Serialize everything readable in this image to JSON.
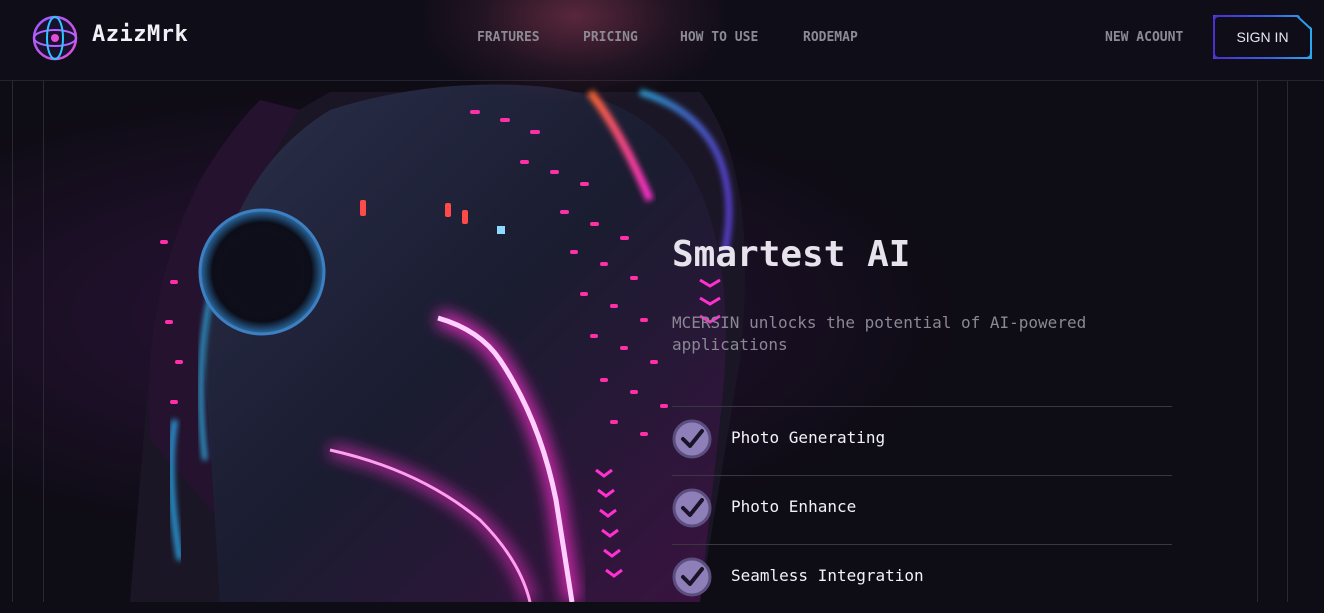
{
  "brand": {
    "name": "AzizMrk",
    "logo_icon": "globe-orbit-icon"
  },
  "nav": {
    "links": [
      "FRATURES",
      "PRICING",
      "HOW TO USE",
      "RODEMAP"
    ],
    "new_account": "NEW ACOUNT",
    "sign_in": "SIGN IN"
  },
  "hero": {
    "title": "Smartest AI",
    "subtitle": "MCERSIN unlocks the potential of AI-powered applications",
    "features": [
      "Photo Generating",
      "Photo Enhance",
      "Seamless Integration"
    ],
    "feature_icon": "check-circle-icon",
    "image": "neon-robot-head-illustration"
  },
  "colors": {
    "background": "#0e0c14",
    "accent_purple": "#5b3ad6",
    "accent_blue": "#2aa8f0",
    "neon_pink": "#ff2fd0",
    "check_fill": "#8f7fb8"
  }
}
